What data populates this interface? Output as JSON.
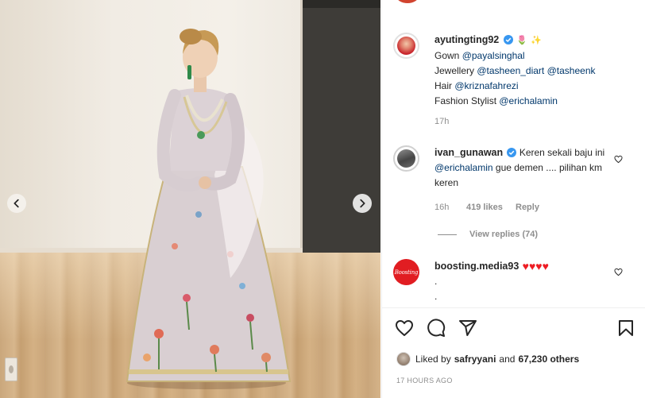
{
  "post_caption": {
    "username": "ayutingting92",
    "emojis": [
      "🌷",
      "✨"
    ],
    "lines": [
      {
        "label": "Gown",
        "mentions": [
          "@payalsinghal"
        ]
      },
      {
        "label": "Jewellery",
        "mentions": [
          "@tasheen_diart",
          "@tasheenk"
        ]
      },
      {
        "label": "Hair",
        "mentions": [
          "@kriznafahrezi"
        ]
      },
      {
        "label": "Fashion Stylist",
        "mentions": [
          "@erichalamin"
        ]
      }
    ],
    "time": "17h"
  },
  "comments": [
    {
      "username": "ivan_gunawan",
      "text_before": "Keren sekali baju ini",
      "mention": "@erichalamin",
      "text_after": "gue demen .... pilihan km keren",
      "time": "16h",
      "likes": "419 likes",
      "reply": "Reply",
      "view_replies": "View replies (74)"
    },
    {
      "username": "boosting.media93",
      "avatar_text": "Boosting",
      "hearts": "♥♥♥♥",
      "line2": ".",
      "line3": "."
    }
  ],
  "likes": {
    "prefix": "Liked by",
    "user": "safryyani",
    "joiner": "and",
    "count": "67,230 others"
  },
  "timestamp": "17 HOURS AGO",
  "icons": {
    "like": "heart-outline-icon",
    "comment": "comment-bubble-icon",
    "share": "paper-plane-icon",
    "save": "bookmark-icon",
    "verified": "verified-badge-icon"
  },
  "colors": {
    "mention": "#00376b",
    "verified": "#3897f0",
    "heart": "#ed1d24",
    "muted": "#8e8e8e"
  }
}
